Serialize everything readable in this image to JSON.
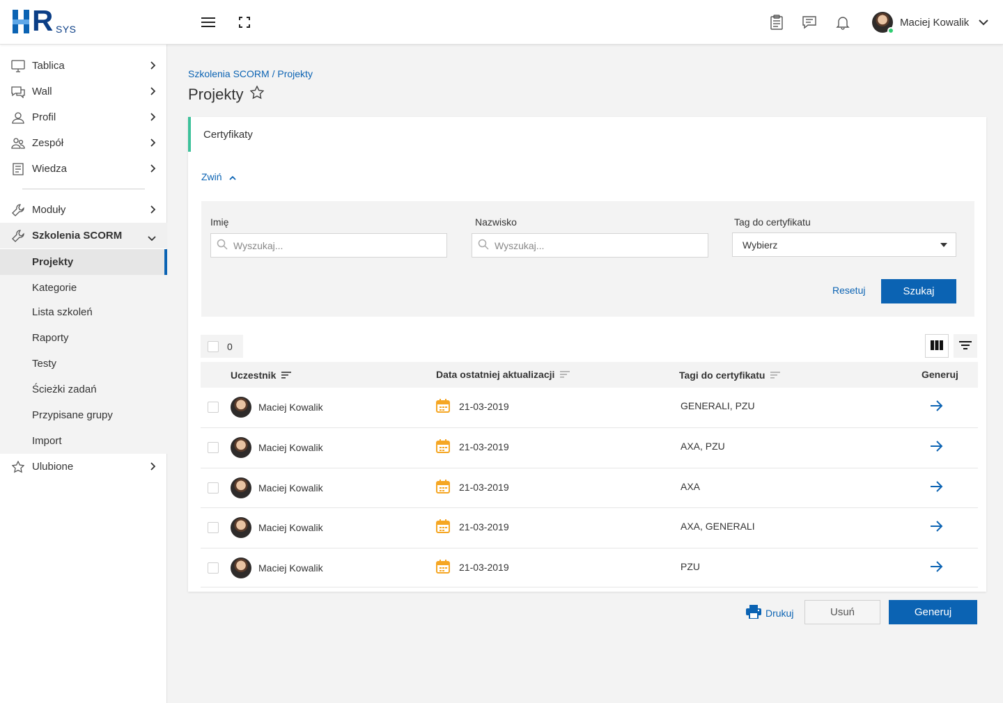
{
  "app": {
    "logo_text": "HR",
    "logo_suffix": "SYS"
  },
  "header": {
    "user_name": "Maciej Kowalik"
  },
  "sidebar": {
    "items": [
      {
        "label": "Tablica",
        "icon": "monitor-icon"
      },
      {
        "label": "Wall",
        "icon": "chat-icon"
      },
      {
        "label": "Profil",
        "icon": "user-icon"
      },
      {
        "label": "Zespół",
        "icon": "team-icon"
      },
      {
        "label": "Wiedza",
        "icon": "document-icon"
      }
    ],
    "moduly": {
      "label": "Moduły",
      "icon": "wrench-icon"
    },
    "scorm": {
      "label": "Szkolenia SCORM",
      "icon": "wrench-icon"
    },
    "subitems": [
      "Projekty",
      "Kategorie",
      "Lista szkoleń",
      "Raporty",
      "Testy",
      "Ścieżki zadań",
      "Przypisane grupy",
      "Import"
    ],
    "ulubione": {
      "label": "Ulubione",
      "icon": "star-icon"
    }
  },
  "breadcrumb": {
    "parent": "Szkolenia SCORM",
    "separator": " / ",
    "current": "Projekty"
  },
  "page": {
    "title": "Projekty"
  },
  "card": {
    "title": "Certyfikaty",
    "collapse_label": "Zwiń"
  },
  "filters": {
    "first_name_label": "Imię",
    "first_name_placeholder": "Wyszukaj...",
    "last_name_label": "Nazwisko",
    "last_name_placeholder": "Wyszukaj...",
    "tag_label": "Tag do certyfikatu",
    "tag_value": "Wybierz",
    "reset_label": "Resetuj",
    "search_label": "Szukaj"
  },
  "table": {
    "selected_count": "0",
    "columns": {
      "participant": "Uczestnik",
      "last_update": "Data ostatniej aktualizacji",
      "tags": "Tagi do certyfikatu",
      "generate": "Generuj"
    },
    "rows": [
      {
        "name": "Maciej Kowalik",
        "date": "21-03-2019",
        "tags": "GENERALI, PZU"
      },
      {
        "name": "Maciej Kowalik",
        "date": "21-03-2019",
        "tags": "AXA, PZU"
      },
      {
        "name": "Maciej Kowalik",
        "date": "21-03-2019",
        "tags": "AXA"
      },
      {
        "name": "Maciej Kowalik",
        "date": "21-03-2019",
        "tags": "AXA, GENERALI"
      },
      {
        "name": "Maciej Kowalik",
        "date": "21-03-2019",
        "tags": "PZU"
      }
    ]
  },
  "footer_actions": {
    "print_label": "Drukuj",
    "delete_label": "Usuń",
    "generate_label": "Generuj"
  },
  "colors": {
    "primary": "#0b63b3",
    "accent_green": "#3cc19a",
    "calendar": "#f5a623"
  }
}
